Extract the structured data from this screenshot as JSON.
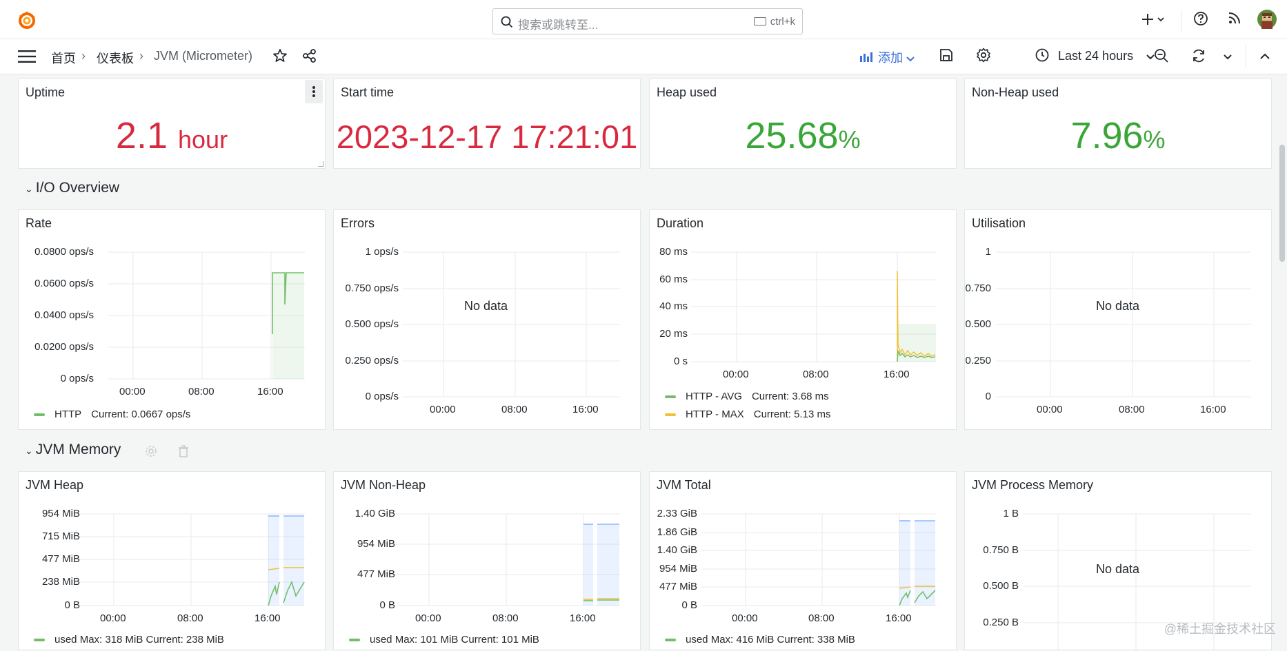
{
  "search": {
    "placeholder": "搜索或跳转至...",
    "shortcut": "ctrl+k"
  },
  "breadcrumb": {
    "home": "首页",
    "dashboards": "仪表板",
    "current": "JVM (Micrometer)",
    "sep": "›"
  },
  "toolbar": {
    "add_label": "添加",
    "time_range": "Last 24 hours"
  },
  "icons": {
    "logo": "grafana-logo-icon",
    "search": "search-icon",
    "plus": "plus-icon",
    "help": "help-icon",
    "news": "rss-icon",
    "avatar": "avatar"
  },
  "colors": {
    "red": "#d8293f",
    "green": "#3aa637",
    "series_green": "#73bf69",
    "series_yellow": "#f2c037",
    "series_blue": "#8ab8ff",
    "link_blue": "#3d71d9"
  },
  "stats": [
    {
      "title": "Uptime",
      "value": "2.1",
      "unit": "hour",
      "color": "#d8293f"
    },
    {
      "title": "Start time",
      "value": "2023-12-17 17:21:01",
      "unit": "",
      "color": "#d8293f"
    },
    {
      "title": "Heap used",
      "value": "25.68",
      "unit": "%",
      "color": "#3aa637"
    },
    {
      "title": "Non-Heap used",
      "value": "7.96",
      "unit": "%",
      "color": "#3aa637"
    }
  ],
  "rows": {
    "io": "I/O Overview",
    "memory": "JVM Memory"
  },
  "panels": {
    "rate": {
      "title": "Rate",
      "y_ticks": [
        "0.0800 ops/s",
        "0.0600 ops/s",
        "0.0400 ops/s",
        "0.0200 ops/s",
        "0 ops/s"
      ],
      "x_ticks": [
        "00:00",
        "08:00",
        "16:00"
      ],
      "legend": [
        {
          "name": "HTTP",
          "current": "Current: 0.0667 ops/s",
          "color": "#73bf69"
        }
      ]
    },
    "errors": {
      "title": "Errors",
      "no_data": "No data",
      "y_ticks": [
        "1 ops/s",
        "0.750 ops/s",
        "0.500 ops/s",
        "0.250 ops/s",
        "0 ops/s"
      ],
      "x_ticks": [
        "00:00",
        "08:00",
        "16:00"
      ]
    },
    "duration": {
      "title": "Duration",
      "y_ticks": [
        "80 ms",
        "60 ms",
        "40 ms",
        "20 ms",
        "0 s"
      ],
      "x_ticks": [
        "00:00",
        "08:00",
        "16:00"
      ],
      "legend": [
        {
          "name": "HTTP - AVG",
          "current": "Current: 3.68 ms",
          "color": "#73bf69"
        },
        {
          "name": "HTTP - MAX",
          "current": "Current: 5.13 ms",
          "color": "#f2c037"
        }
      ]
    },
    "utilisation": {
      "title": "Utilisation",
      "no_data": "No data",
      "y_ticks": [
        "1",
        "0.750",
        "0.500",
        "0.250",
        "0"
      ],
      "x_ticks": [
        "00:00",
        "08:00",
        "16:00"
      ]
    },
    "heap": {
      "title": "JVM Heap",
      "y_ticks": [
        "954 MiB",
        "715 MiB",
        "477 MiB",
        "238 MiB",
        "0 B"
      ],
      "x_ticks": [
        "00:00",
        "08:00",
        "16:00"
      ],
      "legend": "used   Max: 318 MiB  Current: 238 MiB"
    },
    "nonheap": {
      "title": "JVM Non-Heap",
      "y_ticks": [
        "1.40 GiB",
        "954 MiB",
        "477 MiB",
        "0 B"
      ],
      "x_ticks": [
        "00:00",
        "08:00",
        "16:00"
      ],
      "legend": "used   Max: 101 MiB  Current: 101 MiB"
    },
    "total": {
      "title": "JVM Total",
      "y_ticks": [
        "2.33 GiB",
        "1.86 GiB",
        "1.40 GiB",
        "954 MiB",
        "477 MiB",
        "0 B"
      ],
      "x_ticks": [
        "00:00",
        "08:00",
        "16:00"
      ],
      "legend": "used   Max: 416 MiB  Current: 338 MiB"
    },
    "process": {
      "title": "JVM Process Memory",
      "no_data": "No data",
      "y_ticks": [
        "1 B",
        "0.750 B",
        "0.500 B",
        "0.250 B"
      ]
    }
  },
  "watermark": "@稀土掘金技术社区"
}
